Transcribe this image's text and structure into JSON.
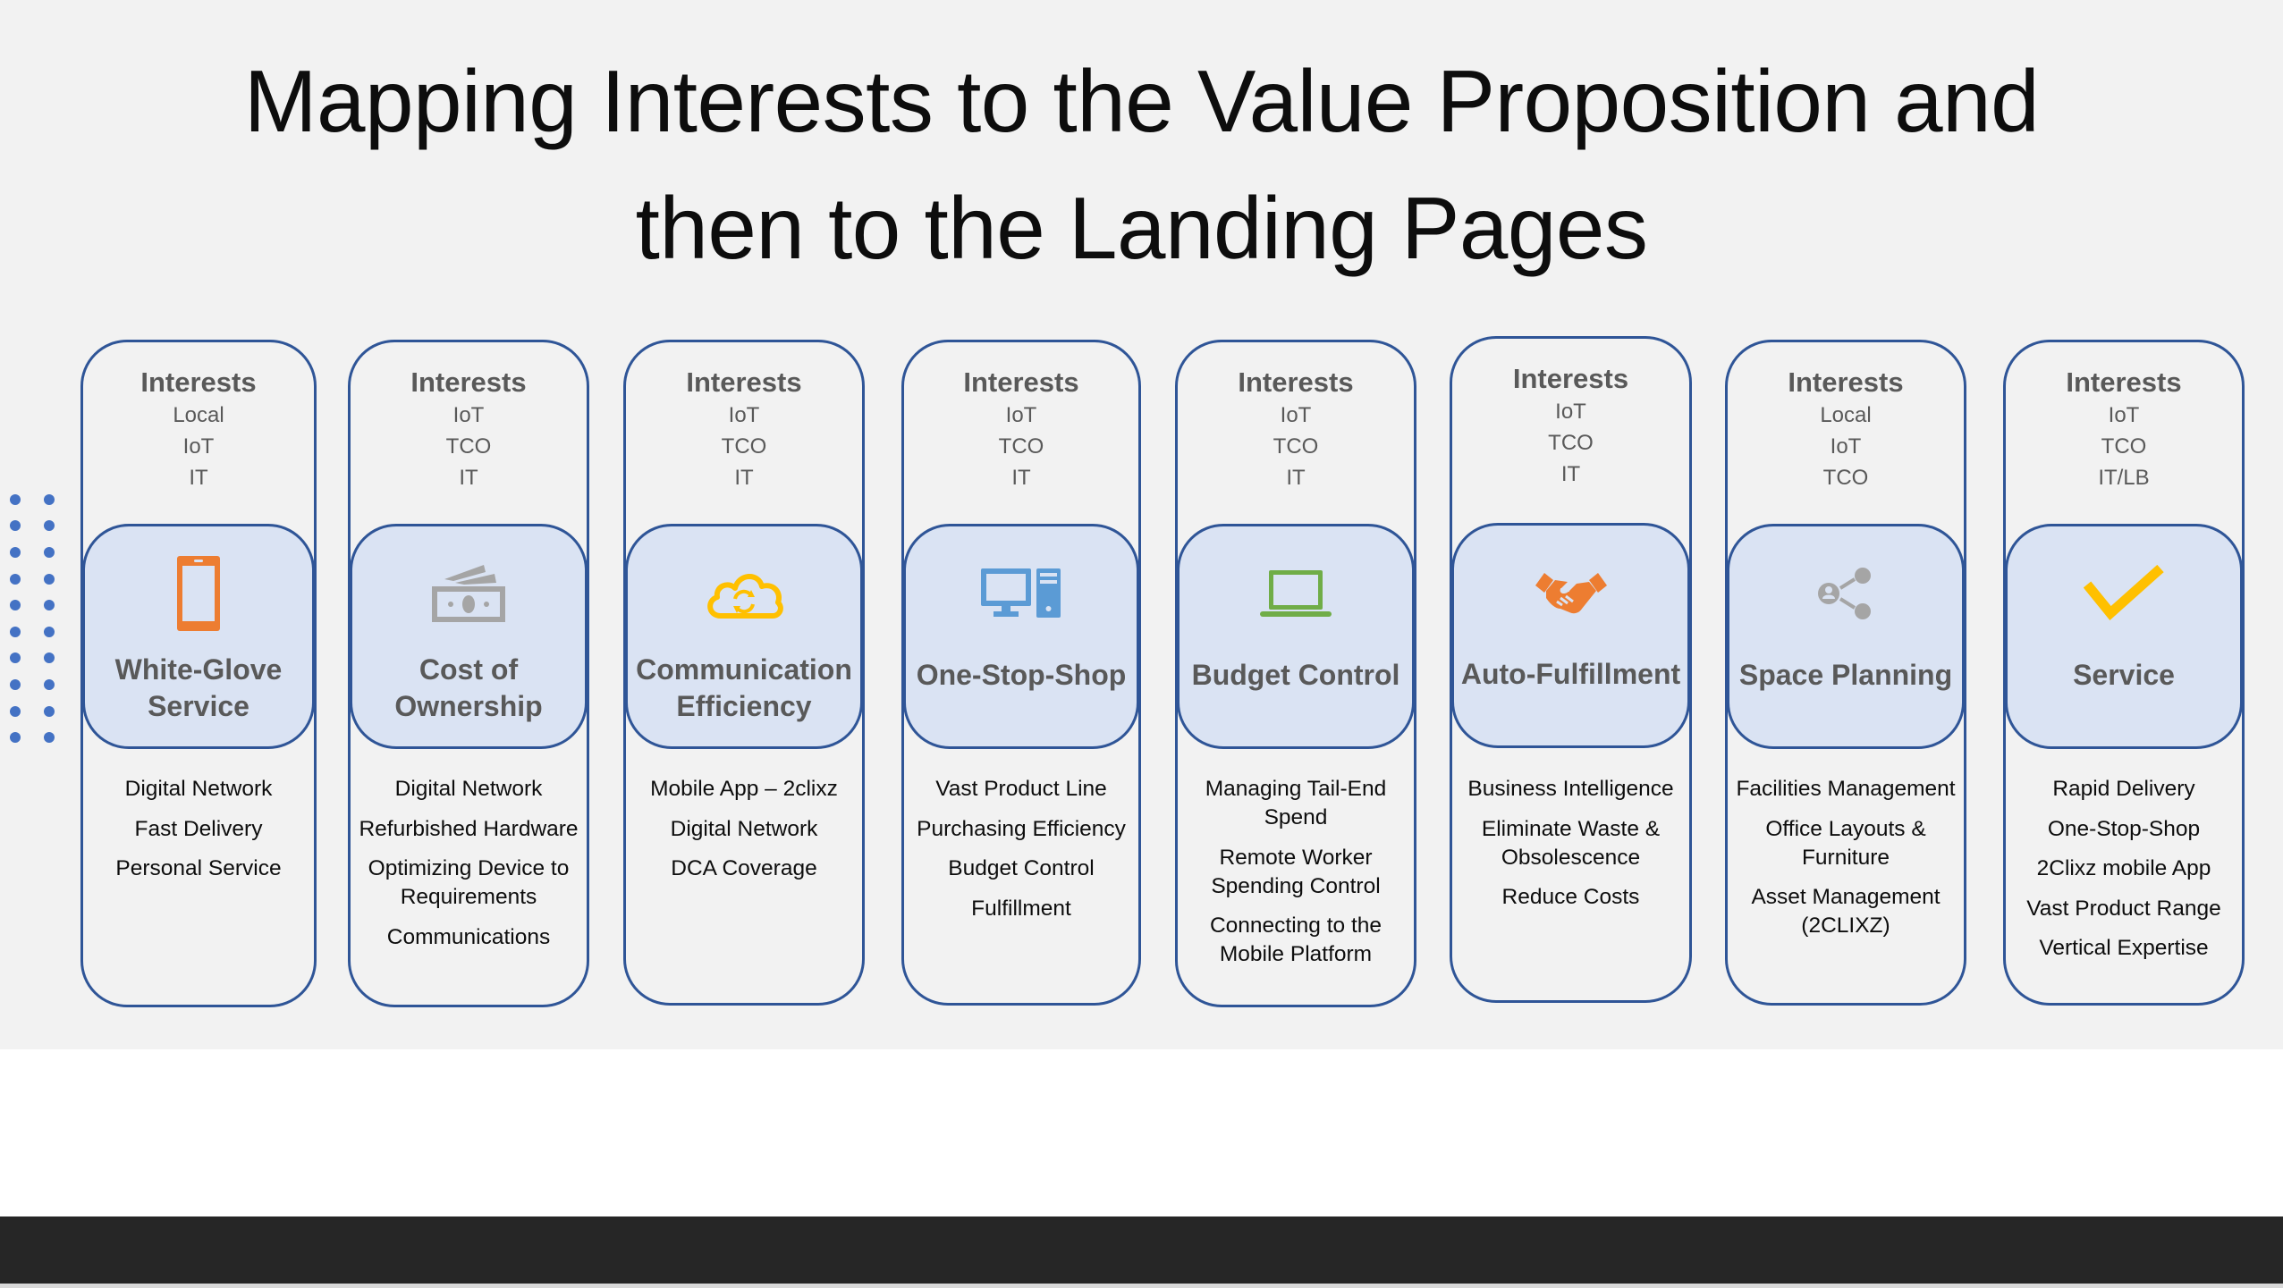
{
  "title": {
    "line1": "Mapping Interests to the Value Proposition and",
    "line2": "then to the Landing Pages"
  },
  "colors": {
    "slide_bg": "#F2F2F2",
    "card_border": "#2F5597",
    "inner_fill": "#DAE3F3",
    "dot": "#4472C4",
    "bottom_bar": "#262626"
  },
  "cards": [
    {
      "interests_label": "Interests",
      "interests": [
        "Local",
        "IoT",
        "IT"
      ],
      "icon": "mobile-phone-icon",
      "icon_color": "#ED7D31",
      "value_label": "White-Glove Service",
      "features": [
        "Digital Network",
        "Fast Delivery",
        "Personal Service"
      ]
    },
    {
      "interests_label": "Interests",
      "interests": [
        "IoT",
        "TCO",
        "IT"
      ],
      "icon": "money-icon",
      "icon_color": "#A5A5A5",
      "value_label": "Cost of Ownership",
      "features": [
        "Digital Network",
        "Refurbished Hardware",
        "Optimizing Device to Requirements",
        "Communications"
      ]
    },
    {
      "interests_label": "Interests",
      "interests": [
        "IoT",
        "TCO",
        "IT"
      ],
      "icon": "cloud-sync-icon",
      "icon_color": "#FFC000",
      "value_label": "Communication Efficiency",
      "features": [
        "Mobile App – 2clixz",
        "Digital Network",
        "DCA Coverage"
      ]
    },
    {
      "interests_label": "Interests",
      "interests": [
        "IoT",
        "TCO",
        "IT"
      ],
      "icon": "desktop-computer-icon",
      "icon_color": "#5B9BD5",
      "value_label": "One-Stop-Shop",
      "features": [
        "Vast Product Line",
        "Purchasing Efficiency",
        "Budget Control",
        "Fulfillment"
      ]
    },
    {
      "interests_label": "Interests",
      "interests": [
        "IoT",
        "TCO",
        "IT"
      ],
      "icon": "laptop-icon",
      "icon_color": "#70AD47",
      "value_label": "Budget Control",
      "features": [
        "Managing Tail-End Spend",
        "Remote Worker Spending Control",
        "Connecting to the Mobile Platform"
      ]
    },
    {
      "interests_label": "Interests",
      "interests": [
        "IoT",
        "TCO",
        "IT"
      ],
      "icon": "handshake-icon",
      "icon_color": "#ED7D31",
      "value_label": "Auto-Fulfillment",
      "features": [
        "Business Intelligence",
        "Eliminate Waste & Obsolescence",
        "Reduce Costs"
      ]
    },
    {
      "interests_label": "Interests",
      "interests": [
        "Local",
        "IoT",
        "TCO"
      ],
      "icon": "share-user-icon",
      "icon_color": "#A5A5A5",
      "value_label": "Space Planning",
      "features": [
        "Facilities Management",
        "Office Layouts & Furniture",
        "Asset Management (2CLIXZ)"
      ]
    },
    {
      "interests_label": "Interests",
      "interests": [
        "IoT",
        "TCO",
        "IT/LB"
      ],
      "icon": "checkmark-icon",
      "icon_color": "#FFC000",
      "value_label": "Service",
      "features": [
        "Rapid Delivery",
        "One-Stop-Shop",
        "2Clixz mobile App",
        "Vast Product Range",
        "Vertical Expertise"
      ]
    }
  ]
}
